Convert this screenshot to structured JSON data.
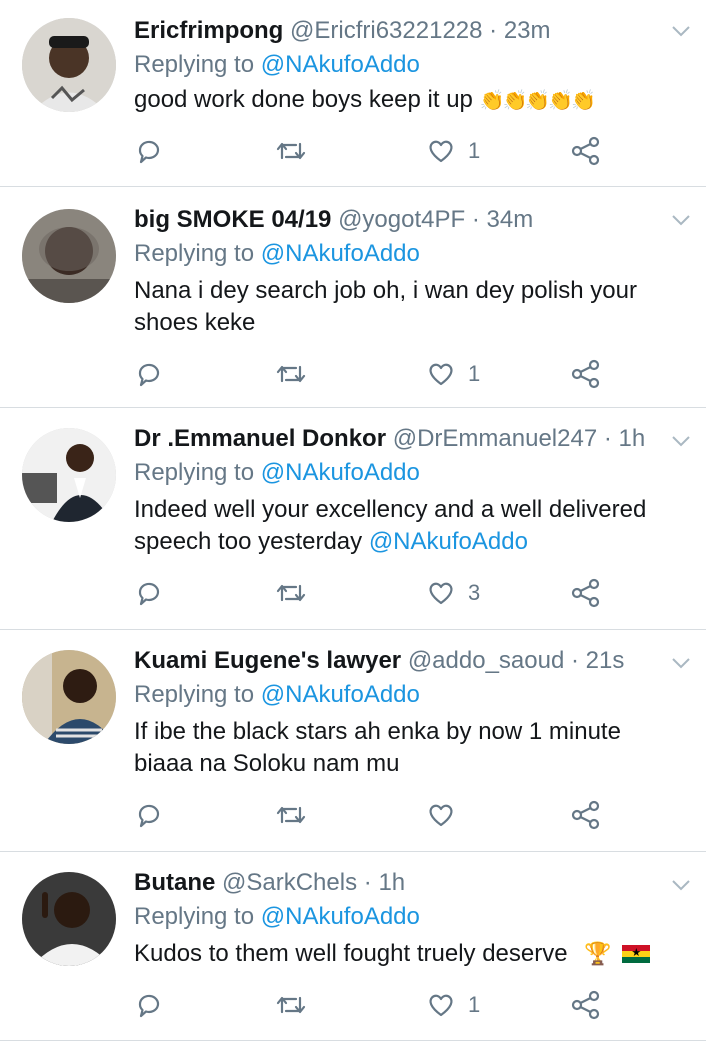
{
  "tweets": [
    {
      "name": "Ericfrimpong",
      "handle": "@Ericfri63221228",
      "sep": "·",
      "time": "23m",
      "replying_prefix": "Replying to",
      "replying_to": "@NAkufoAddo",
      "text": "good work done boys keep it up",
      "emoji": "👏👏👏👏👏",
      "like_count": "1"
    },
    {
      "name": "big SMOKE 04/19",
      "handle": "@yogot4PF",
      "sep": "·",
      "time": "34m",
      "replying_prefix": "Replying to",
      "replying_to": "@NAkufoAddo",
      "text": "Nana i dey search job oh, i wan dey polish your shoes keke",
      "like_count": "1"
    },
    {
      "name": "Dr .Emmanuel Donkor",
      "handle": "@DrEmmanuel247",
      "sep": "·",
      "time": "1h",
      "replying_prefix": "Replying to",
      "replying_to": "@NAkufoAddo",
      "text": "Indeed well your excellency and a well delivered speech too yesterday",
      "text_mention": "@NAkufoAddo",
      "like_count": "3"
    },
    {
      "name": "Kuami Eugene's lawyer",
      "handle": "@addo_saoud",
      "sep": "·",
      "time": "21s",
      "replying_prefix": "Replying to",
      "replying_to": "@NAkufoAddo",
      "text": "If ibe the black stars ah enka by now 1 minute biaaa na Soloku nam mu",
      "like_count": ""
    },
    {
      "name": "Butane",
      "handle": "@SarkChels",
      "sep": "·",
      "time": "1h",
      "replying_prefix": "Replying to",
      "replying_to": "@NAkufoAddo",
      "text": "Kudos to them well fought truely deserve",
      "emoji": "🏆",
      "like_count": "1"
    }
  ],
  "icons": {
    "reply": "reply-icon",
    "retweet": "retweet-icon",
    "like": "heart-icon",
    "share": "share-icon",
    "menu": "chevron-down-icon"
  },
  "colors": {
    "link": "#1b95e0",
    "secondary": "#657786",
    "text": "#14171a",
    "divider": "#d8dde1"
  }
}
